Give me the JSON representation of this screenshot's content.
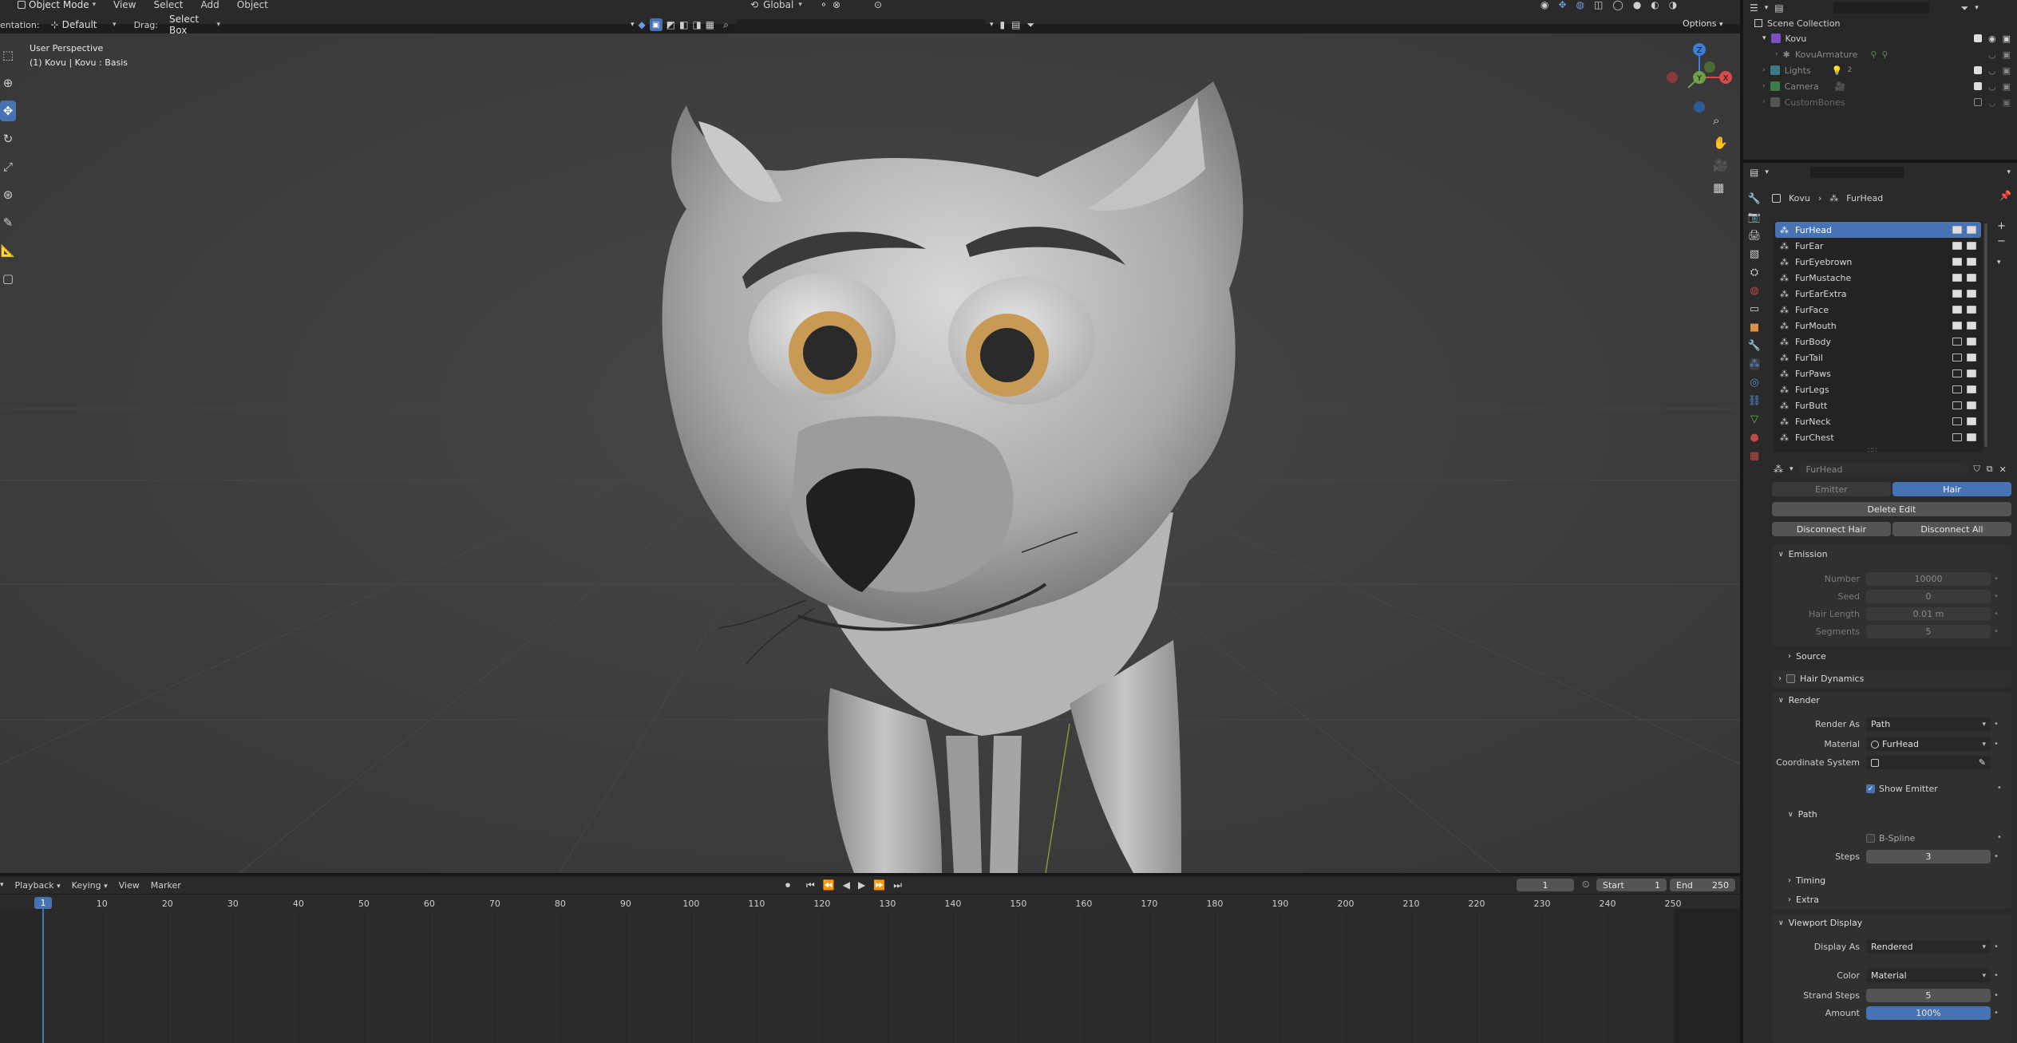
{
  "header": {
    "mode": "Object Mode",
    "menus": [
      "View",
      "Select",
      "Add",
      "Object"
    ],
    "orientation_label": "entation:",
    "orientation_value": "Default",
    "drag_label": "Drag:",
    "drag_value": "Select Box",
    "transform_orientation": "Global",
    "options": "Options"
  },
  "viewport": {
    "perspective": "User Perspective",
    "object_info": "(1) Kovu | Kovu : Basis",
    "gizmo": {
      "z": "Z",
      "y": "Y",
      "x": "X"
    }
  },
  "outliner": {
    "title": "Scene Collection",
    "items": [
      {
        "label": "Kovu",
        "level": 1
      },
      {
        "label": "KovuArmature",
        "level": 2
      },
      {
        "label": "Lights",
        "level": 1,
        "badge": "2"
      },
      {
        "label": "Camera",
        "level": 1
      },
      {
        "label": "CustomBones",
        "level": 1
      }
    ]
  },
  "properties": {
    "breadcrumb": [
      "Kovu",
      "FurHead"
    ],
    "systems": [
      "FurHead",
      "FurEar",
      "FurEyebrown",
      "FurMustache",
      "FurEarExtra",
      "FurFace",
      "FurMouth",
      "FurBody",
      "FurTail",
      "FurPaws",
      "FurLegs",
      "FurButt",
      "FurNeck",
      "FurChest"
    ],
    "systems_rendered_count": 7,
    "settings_name": "FurHead",
    "type_tabs": [
      "Emitter",
      "Hair"
    ],
    "active_type": "Hair",
    "delete_edit": "Delete Edit",
    "disconnect_hair": "Disconnect Hair",
    "disconnect_all": "Disconnect All",
    "emission": {
      "title": "Emission",
      "number_label": "Number",
      "number": "10000",
      "seed_label": "Seed",
      "seed": "0",
      "hair_length_label": "Hair Length",
      "hair_length": "0.01 m",
      "segments_label": "Segments",
      "segments": "5"
    },
    "source": "Source",
    "hair_dynamics": "Hair Dynamics",
    "render": {
      "title": "Render",
      "render_as_label": "Render As",
      "render_as": "Path",
      "material_label": "Material",
      "material": "FurHead",
      "coord_label": "Coordinate System",
      "show_emitter": "Show Emitter",
      "path": "Path",
      "bspline": "B-Spline",
      "steps_label": "Steps",
      "steps": "3",
      "timing": "Timing",
      "extra": "Extra"
    },
    "viewport_display": {
      "title": "Viewport Display",
      "display_as_label": "Display As",
      "display_as": "Rendered",
      "color_label": "Color",
      "color": "Material",
      "strand_steps_label": "Strand Steps",
      "strand_steps": "5",
      "amount_label": "Amount",
      "amount": "100%",
      "amount_fraction": 1.0
    }
  },
  "timeline": {
    "menus": [
      "Playback",
      "Keying",
      "View",
      "Marker"
    ],
    "current_frame": "1",
    "start_label": "Start",
    "start": "1",
    "end_label": "End",
    "end": "250",
    "ticks": [
      "1",
      "10",
      "20",
      "30",
      "40",
      "50",
      "60",
      "70",
      "80",
      "90",
      "100",
      "110",
      "120",
      "130",
      "140",
      "150",
      "160",
      "170",
      "180",
      "190",
      "200",
      "210",
      "220",
      "230",
      "240",
      "250"
    ]
  },
  "colors": {
    "accent": "#4772b3",
    "panel": "#303030",
    "viewport": "#3d3d3d",
    "eye_iris": "#c89a55"
  }
}
